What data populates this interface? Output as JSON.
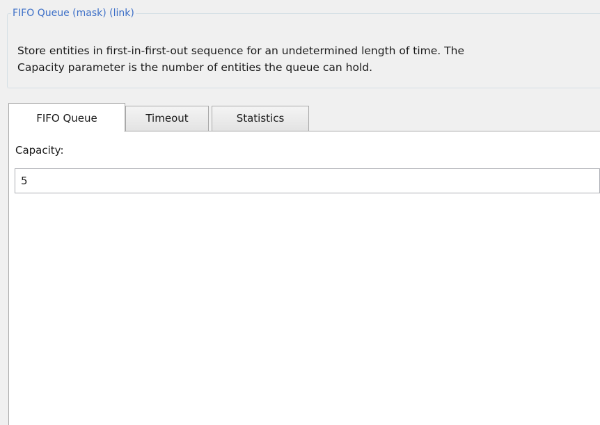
{
  "description_group": {
    "title": "FIFO Queue (mask) (link)",
    "text_line_1": "Store entities in first-in-first-out sequence for an undetermined length of time. The",
    "text_line_2": "Capacity parameter is the number of entities the queue can hold."
  },
  "tabs": [
    {
      "label": "FIFO Queue",
      "active": true
    },
    {
      "label": "Timeout",
      "active": false
    },
    {
      "label": "Statistics",
      "active": false
    }
  ],
  "fifo_tab": {
    "capacity_label": "Capacity:",
    "capacity_value": "5"
  }
}
